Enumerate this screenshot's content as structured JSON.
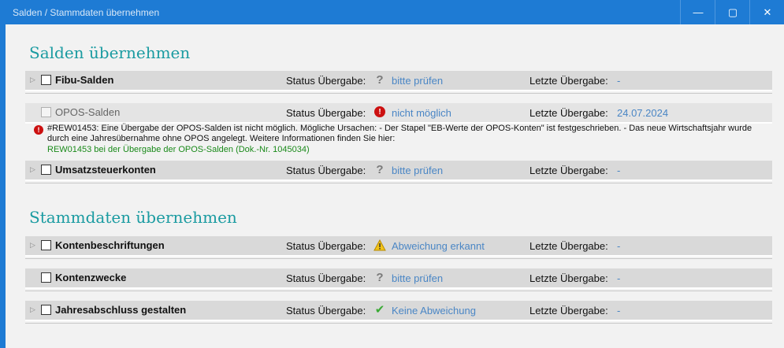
{
  "window": {
    "title": "Salden / Stammdaten übernehmen",
    "minimize": "—",
    "maximize": "▢",
    "close": "✕"
  },
  "sections": {
    "salden_title": "Salden übernehmen",
    "stammdaten_title": "Stammdaten übernehmen"
  },
  "common": {
    "status_label": "Status Übergabe:",
    "last_label": "Letzte Übergabe:"
  },
  "rows": [
    {
      "label": "Fibu-Salden",
      "status": "bitte prüfen",
      "status_icon": "question-icon",
      "last": "-"
    },
    {
      "label": "OPOS-Salden",
      "status": "nicht möglich",
      "status_icon": "error-icon",
      "last": "24.07.2024"
    },
    {
      "label": "Umsatzsteuerkonten",
      "status": "bitte prüfen",
      "status_icon": "question-icon",
      "last": "-"
    },
    {
      "label": "Kontenbeschriftungen",
      "status": "Abweichung erkannt",
      "status_icon": "warning-icon",
      "last": "-"
    },
    {
      "label": "Kontenzwecke",
      "status": "bitte prüfen",
      "status_icon": "question-icon",
      "last": "-"
    },
    {
      "label": "Jahresabschluss gestalten",
      "status": "Keine Abweichung",
      "status_icon": "check-icon",
      "last": "-"
    }
  ],
  "error_message": {
    "text": "#REW01453: Eine Übergabe der OPOS-Salden ist nicht möglich. Mögliche Ursachen: - Der Stapel \"EB-Werte der OPOS-Konten\" ist festgeschrieben. - Das neue Wirtschaftsjahr wurde durch eine Jahresübernahme ohne OPOS angelegt.  Weitere Informationen finden Sie hier:",
    "link": "REW01453 bei der Übergabe der OPOS-Salden (Dok.-Nr. 1045034)"
  },
  "colors": {
    "titlebar": "#1e7bd4",
    "section_title": "#1a9ba1",
    "status_value": "#4a86c5",
    "error": "#cc1010",
    "link": "#1a8a1a"
  }
}
